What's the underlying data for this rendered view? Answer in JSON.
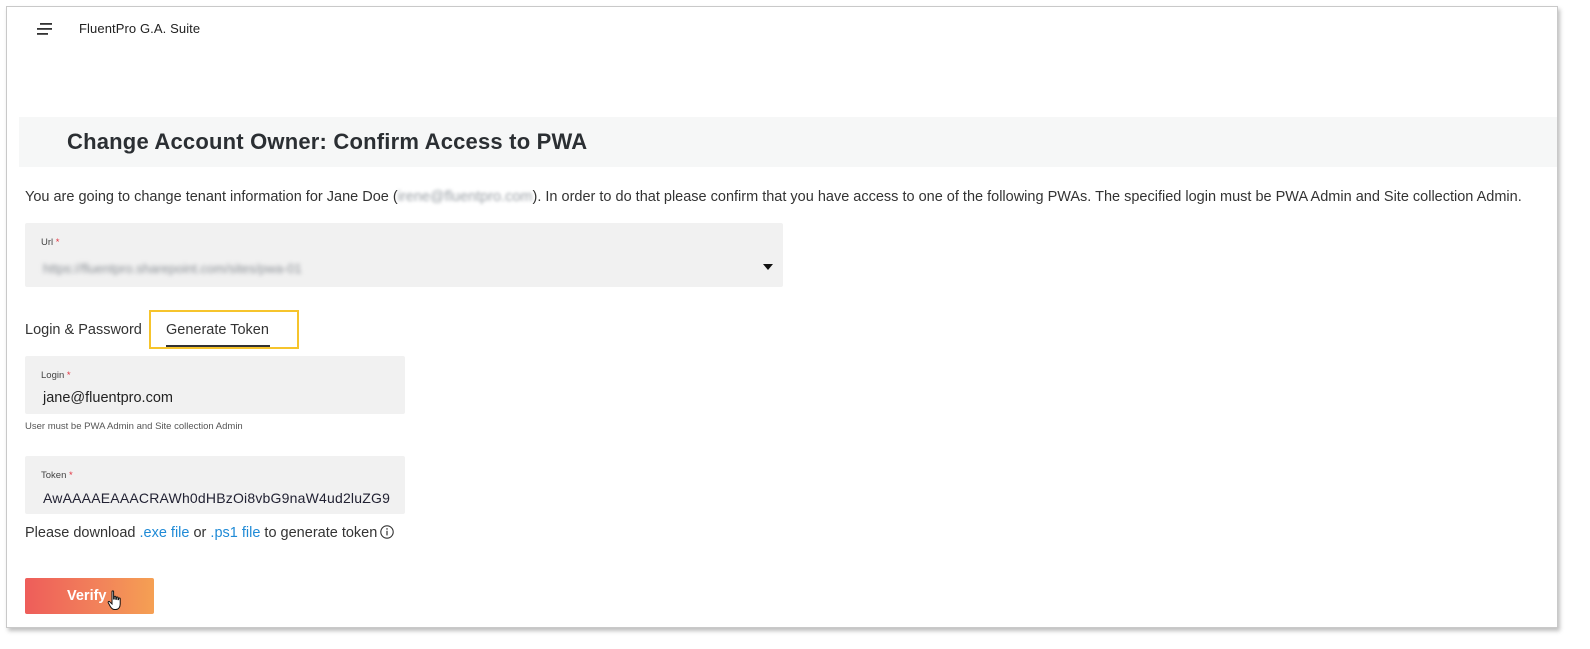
{
  "app": {
    "title": "FluentPro G.A. Suite"
  },
  "page": {
    "title": "Change Account Owner: Confirm Access to PWA",
    "intro_before": "You are going to change tenant information for Jane Doe (",
    "intro_email": "irene@fluentpro.com",
    "intro_after": "). In order to do that please confirm that you have access to one of the following PWAs. The specified login must be PWA Admin and Site collection Admin."
  },
  "url_field": {
    "label": "Url",
    "required_mark": "*",
    "value": "https://fluentpro.sharepoint.com/sites/pwa-01"
  },
  "tabs": [
    {
      "label": "Login & Password",
      "active": false
    },
    {
      "label": "Generate Token",
      "active": true
    }
  ],
  "login_field": {
    "label": "Login",
    "required_mark": "*",
    "value": "jane@fluentpro.com",
    "hint": "User must be PWA Admin and Site collection Admin"
  },
  "token_field": {
    "label": "Token",
    "required_mark": "*",
    "value": "AwAAAAEAAACRAWh0dHBzOi8vbG9naW4ud2luZG9"
  },
  "download": {
    "prefix": "Please download ",
    "exe_link": ".exe file",
    "or": " or ",
    "ps1_link": ".ps1 file",
    "suffix": " to generate token"
  },
  "verify_button": {
    "label": "Verify"
  },
  "colors": {
    "highlight": "#f6c42c",
    "link": "#1f8ad6",
    "required": "#e2323f",
    "button_start": "#ee5d5a",
    "button_end": "#f5a053"
  },
  "icons": {
    "menu": "menu-icon",
    "dropdown": "chevron-down-icon",
    "info": "info-icon",
    "cursor": "hand-pointer-icon"
  }
}
